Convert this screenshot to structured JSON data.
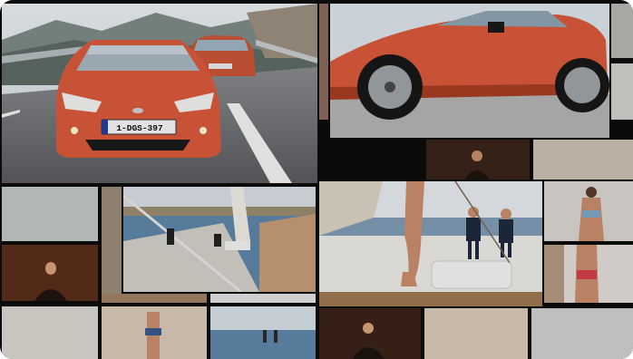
{
  "collage": {
    "license_plate": "1-DGS-397",
    "palette": {
      "car": "#d9593a",
      "car_dark": "#a83c22",
      "sky": "#dfe6ec",
      "road": "#6f6f72",
      "sea": "#5f86a8",
      "deck": "#e6e3dd",
      "skin": "#c98e6e",
      "bikini_blue": "#7fa8c8",
      "bikini_red": "#d23f4a",
      "dark_bg": "#2a1d18",
      "sailor_navy": "#1e2a3e"
    },
    "scenes": [
      "car-on-mountain-road",
      "car-side-parked",
      "harbor-boats",
      "yacht-deck-legs-sailors",
      "woman-bikini",
      "dark-portrait",
      "blurred-beach"
    ]
  }
}
